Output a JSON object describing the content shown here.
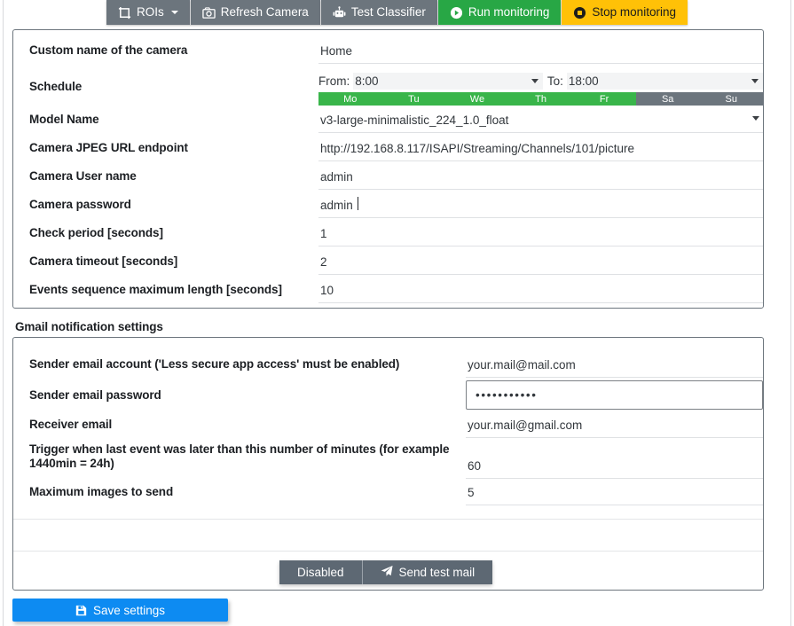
{
  "toolbar": {
    "buttons": [
      {
        "label": "ROIs",
        "icon": "crop-icon",
        "style": "default",
        "caret": true
      },
      {
        "label": "Refresh Camera",
        "icon": "camera-icon",
        "style": "default",
        "caret": false
      },
      {
        "label": "Test Classifier",
        "icon": "robot-icon",
        "style": "default",
        "caret": false
      },
      {
        "label": "Run monitoring",
        "icon": "play-circle-icon",
        "style": "success",
        "caret": false
      },
      {
        "label": "Stop monitoring",
        "icon": "stop-circle-icon",
        "style": "warning",
        "caret": false
      }
    ]
  },
  "camera_settings": {
    "fields": {
      "custom_name": {
        "label": "Custom name of the camera",
        "value": "Home"
      },
      "schedule": {
        "label": "Schedule",
        "from_label": "From:",
        "from_value": "8:00",
        "to_label": "To:",
        "to_value": "18:00",
        "days": [
          {
            "name": "Mo",
            "active": true
          },
          {
            "name": "Tu",
            "active": true
          },
          {
            "name": "We",
            "active": true
          },
          {
            "name": "Th",
            "active": true
          },
          {
            "name": "Fr",
            "active": true
          },
          {
            "name": "Sa",
            "active": false
          },
          {
            "name": "Su",
            "active": false
          }
        ]
      },
      "model_name": {
        "label": "Model Name",
        "value": "v3-large-minimalistic_224_1.0_float"
      },
      "jpeg_url": {
        "label": "Camera JPEG URL endpoint",
        "value": "http://192.168.8.117/ISAPI/Streaming/Channels/101/picture"
      },
      "user_name": {
        "label": "Camera User name",
        "value": "admin"
      },
      "password": {
        "label": "Camera password",
        "value": "admin"
      },
      "check_period": {
        "label": "Check period [seconds]",
        "value": "1"
      },
      "camera_timeout": {
        "label": "Camera timeout [seconds]",
        "value": "2"
      },
      "events_sequence": {
        "label": "Events sequence maximum length [seconds]",
        "value": "10"
      }
    }
  },
  "gmail_settings": {
    "section_title": "Gmail notification settings",
    "fields": {
      "sender_email": {
        "label": "Sender email account ('Less secure app access' must be enabled)",
        "value": "your.mail@mail.com"
      },
      "sender_password": {
        "label": "Sender email password",
        "value": "•••••••••••"
      },
      "receiver_email": {
        "label": "Receiver email",
        "value": "your.mail@gmail.com"
      },
      "trigger_minutes": {
        "label": "Trigger when last event was later than this number of minutes (for example 1440min = 24h)",
        "value": "60"
      },
      "max_images": {
        "label": "Maximum images to send",
        "value": "5"
      }
    },
    "actions": {
      "disabled_label": "Disabled",
      "send_test_label": "Send test mail",
      "send_test_icon": "paper-plane-icon"
    }
  },
  "footer": {
    "save_label": "Save settings",
    "save_icon": "floppy-disk-icon"
  },
  "colors": {
    "toolbar_default": "#6c757d",
    "toolbar_run": "#28a745",
    "toolbar_stop": "#ffc107",
    "day_active": "#39b54a",
    "day_inactive": "#6c757d",
    "save_button": "#0d8bf2",
    "action_button": "#5d6873"
  }
}
